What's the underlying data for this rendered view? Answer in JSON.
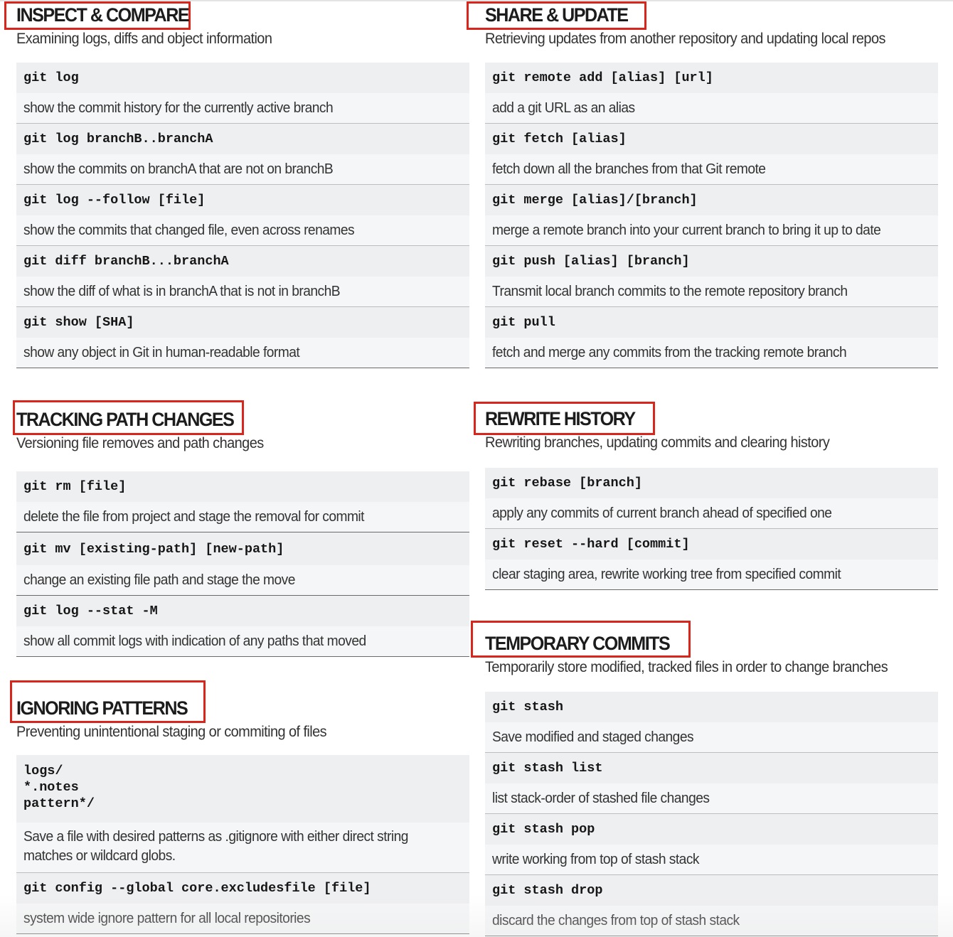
{
  "accent_color": "#d9261c",
  "sections": {
    "inspect": {
      "title": "INSPECT & COMPARE",
      "subtitle": "Examining logs, diffs and object information",
      "rows": [
        {
          "cmd": "git log",
          "desc": "show the commit history for the currently active branch"
        },
        {
          "cmd": "git log branchB..branchA",
          "desc": "show the commits on branchA that are not on branchB"
        },
        {
          "cmd": "git log --follow [file]",
          "desc": "show the commits that changed file, even across renames"
        },
        {
          "cmd": "git diff branchB...branchA",
          "desc": "show the diff of what is in branchA that is not in branchB"
        },
        {
          "cmd": "git show [SHA]",
          "desc": "show any object in Git in human-readable format"
        }
      ]
    },
    "share": {
      "title": "SHARE & UPDATE",
      "subtitle": "Retrieving updates from another repository and updating local repos",
      "rows": [
        {
          "cmd": "git remote add [alias] [url]",
          "desc": "add a git URL as an alias"
        },
        {
          "cmd": "git fetch [alias]",
          "desc": "fetch down all the branches from that Git remote"
        },
        {
          "cmd": "git merge [alias]/[branch]",
          "desc": "merge a remote branch into your current branch to bring it up to date"
        },
        {
          "cmd": "git push [alias] [branch]",
          "desc": "Transmit local branch commits to the remote repository branch"
        },
        {
          "cmd": "git pull",
          "desc": "fetch and merge any commits from the tracking remote branch"
        }
      ]
    },
    "tracking": {
      "title": "TRACKING PATH CHANGES",
      "subtitle": "Versioning file removes and path changes",
      "rows": [
        {
          "cmd": "git rm [file]",
          "desc": "delete the file from project and stage the removal for commit"
        },
        {
          "cmd": "git mv [existing-path] [new-path]",
          "desc": "change an existing file path and stage the move"
        },
        {
          "cmd": "git log --stat -M",
          "desc": "show all commit logs with indication of any paths that moved"
        }
      ]
    },
    "rewrite": {
      "title": "REWRITE HISTORY",
      "subtitle": "Rewriting branches, updating commits and clearing history",
      "rows": [
        {
          "cmd": "git rebase [branch]",
          "desc": "apply any commits of current branch ahead of specified one"
        },
        {
          "cmd": "git reset --hard [commit]",
          "desc": "clear staging area, rewrite working tree from specified commit"
        }
      ]
    },
    "ignoring": {
      "title": "IGNORING PATTERNS",
      "subtitle": "Preventing unintentional staging or commiting of files",
      "rows": [
        {
          "cmd": "logs/\n*.notes\npattern*/",
          "desc": "Save a file with desired patterns as .gitignore with either direct string matches or wildcard globs."
        },
        {
          "cmd": "git config --global core.excludesfile [file]",
          "desc": "system wide ignore pattern for all local repositories"
        }
      ]
    },
    "temporary": {
      "title": "TEMPORARY COMMITS",
      "subtitle": "Temporarily store modified, tracked files  in order to change branches",
      "rows": [
        {
          "cmd": "git stash",
          "desc": "Save modified and staged changes"
        },
        {
          "cmd": "git stash list",
          "desc": "list stack-order of stashed file changes"
        },
        {
          "cmd": "git stash pop",
          "desc": "write working from top of stash stack"
        },
        {
          "cmd": "git stash drop",
          "desc": "discard  the changes from top of stash stack"
        }
      ]
    }
  }
}
